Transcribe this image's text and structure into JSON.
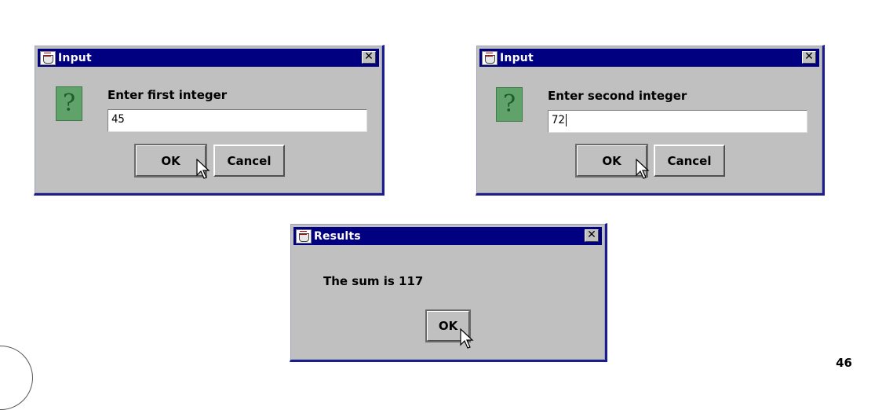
{
  "dialogs": {
    "first": {
      "title": "Input",
      "prompt": "Enter first integer",
      "input_value": "45",
      "ok_label": "OK",
      "cancel_label": "Cancel",
      "close_glyph": "✕"
    },
    "second": {
      "title": "Input",
      "prompt": "Enter second integer",
      "input_value": "72",
      "ok_label": "OK",
      "cancel_label": "Cancel",
      "close_glyph": "✕"
    },
    "results": {
      "title": "Results",
      "message": "The sum is 117",
      "ok_label": "OK",
      "close_glyph": "✕"
    }
  },
  "icons": {
    "question": "?",
    "app": "java-cup-icon"
  },
  "page_number": "46",
  "colors": {
    "titlebar": "#000080",
    "dialog_bg": "#c0c0c0",
    "question_icon": "#5fa36a"
  }
}
